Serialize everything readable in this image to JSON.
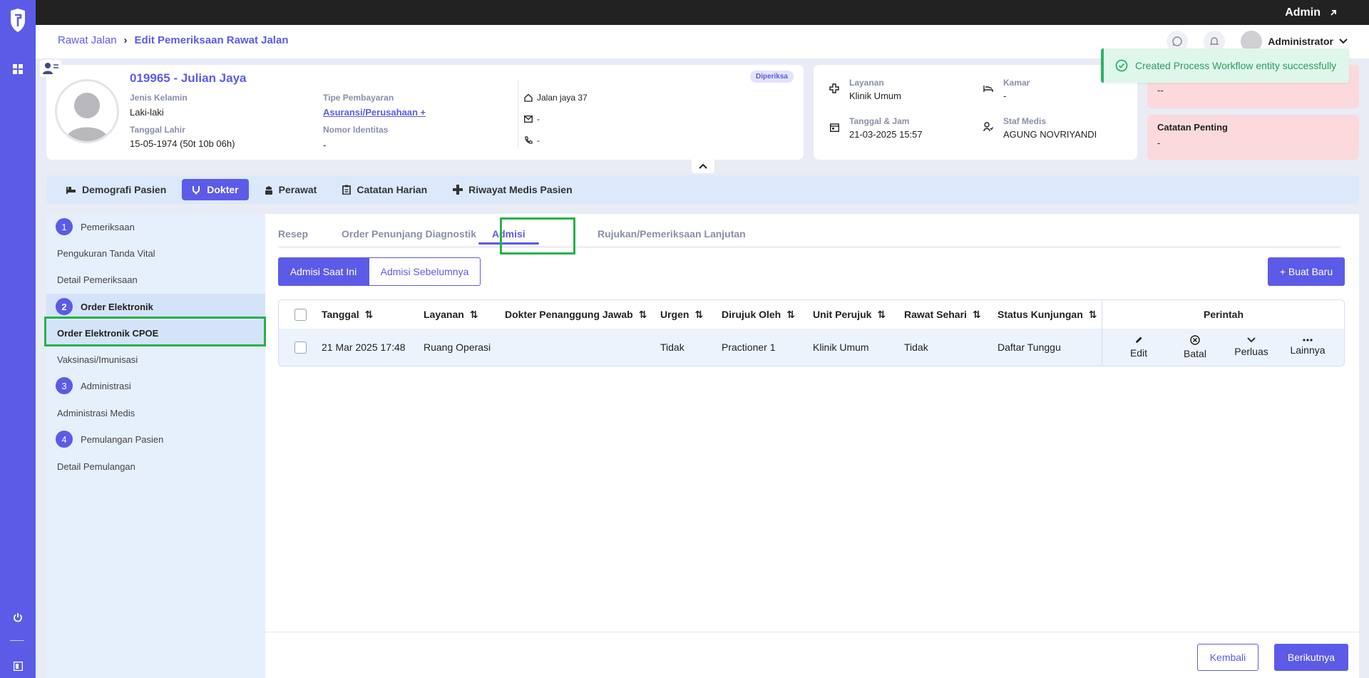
{
  "topbar": {
    "admin_label": "Admin"
  },
  "breadcrumb": {
    "parent": "Rawat Jalan",
    "current": "Edit Pemeriksaan Rawat Jalan"
  },
  "header": {
    "user_name": "Administrator"
  },
  "toast": {
    "message": "Created Process Workflow entity successfully"
  },
  "patient": {
    "title": "019965 - Julian Jaya",
    "status_badge": "Diperiksa",
    "gender_label": "Jenis Kelamin",
    "gender": "Laki-laki",
    "dob_label": "Tanggal Lahir",
    "dob": "15-05-1974 (50t 10b 06h)",
    "payment_label": "Tipe Pembayaran",
    "payment": "Asuransi/Perusahaan +",
    "id_label": "Nomor Identitas",
    "id_value": "-",
    "address": "Jalan jaya 37",
    "email": "-",
    "phone": "-"
  },
  "service": {
    "layanan_label": "Layanan",
    "layanan": "Klinik Umum",
    "kamar_label": "Kamar",
    "kamar": "-",
    "datetime_label": "Tanggal & Jam",
    "datetime": "21-03-2025 15:57",
    "staf_label": "Staf Medis",
    "staf": "AGUNG NOVRIYANDI"
  },
  "notes": {
    "top_value": "--",
    "important_label": "Catatan Penting",
    "important_value": "-"
  },
  "main_tabs": [
    {
      "label": "Demografi Pasien",
      "icon": "bed-icon"
    },
    {
      "label": "Dokter",
      "icon": "stethoscope-icon"
    },
    {
      "label": "Perawat",
      "icon": "nurse-icon"
    },
    {
      "label": "Catatan Harian",
      "icon": "clipboard-icon"
    },
    {
      "label": "Riwayat Medis Pasien",
      "icon": "medical-cross-icon"
    }
  ],
  "steps": [
    {
      "num": "1",
      "label": "Pemeriksaan"
    },
    {
      "label": "Pengukuran Tanda Vital"
    },
    {
      "label": "Detail Pemeriksaan"
    },
    {
      "num": "2",
      "label": "Order Elektronik"
    },
    {
      "label": "Order Elektronik CPOE"
    },
    {
      "label": "Vaksinasi/Imunisasi"
    },
    {
      "num": "3",
      "label": "Administrasi"
    },
    {
      "label": "Administrasi Medis"
    },
    {
      "num": "4",
      "label": "Pemulangan Pasien"
    },
    {
      "label": "Detail Pemulangan"
    }
  ],
  "sub_tabs": [
    "Resep",
    "Order Penunjang Diagnostik",
    "Admisi",
    "Rujukan/Pemeriksaan Lanjutan"
  ],
  "segments": {
    "current": "Admisi Saat Ini",
    "previous": "Admisi Sebelumnya"
  },
  "new_button": "+ Buat Baru",
  "table": {
    "columns": [
      "Tanggal",
      "Layanan",
      "Dokter Penanggung Jawab",
      "Urgen",
      "Dirujuk Oleh",
      "Unit Perujuk",
      "Rawat Sehari",
      "Status Kunjungan",
      "Perintah"
    ],
    "rows": [
      [
        "21 Mar 2025 17:48",
        "Ruang Operasi",
        "",
        "Tidak",
        "Practioner 1",
        "Klinik Umum",
        "Tidak",
        "Daftar Tunggu"
      ]
    ],
    "actions": [
      "Edit",
      "Batal",
      "Perluas",
      "Lainnya"
    ]
  },
  "footer": {
    "back": "Kembali",
    "next": "Berikutnya"
  },
  "colors": {
    "accent": "#5b5be8",
    "highlight": "#26b34a",
    "toast_bg": "#dff7ea",
    "note_bg": "#fbd9dc"
  }
}
